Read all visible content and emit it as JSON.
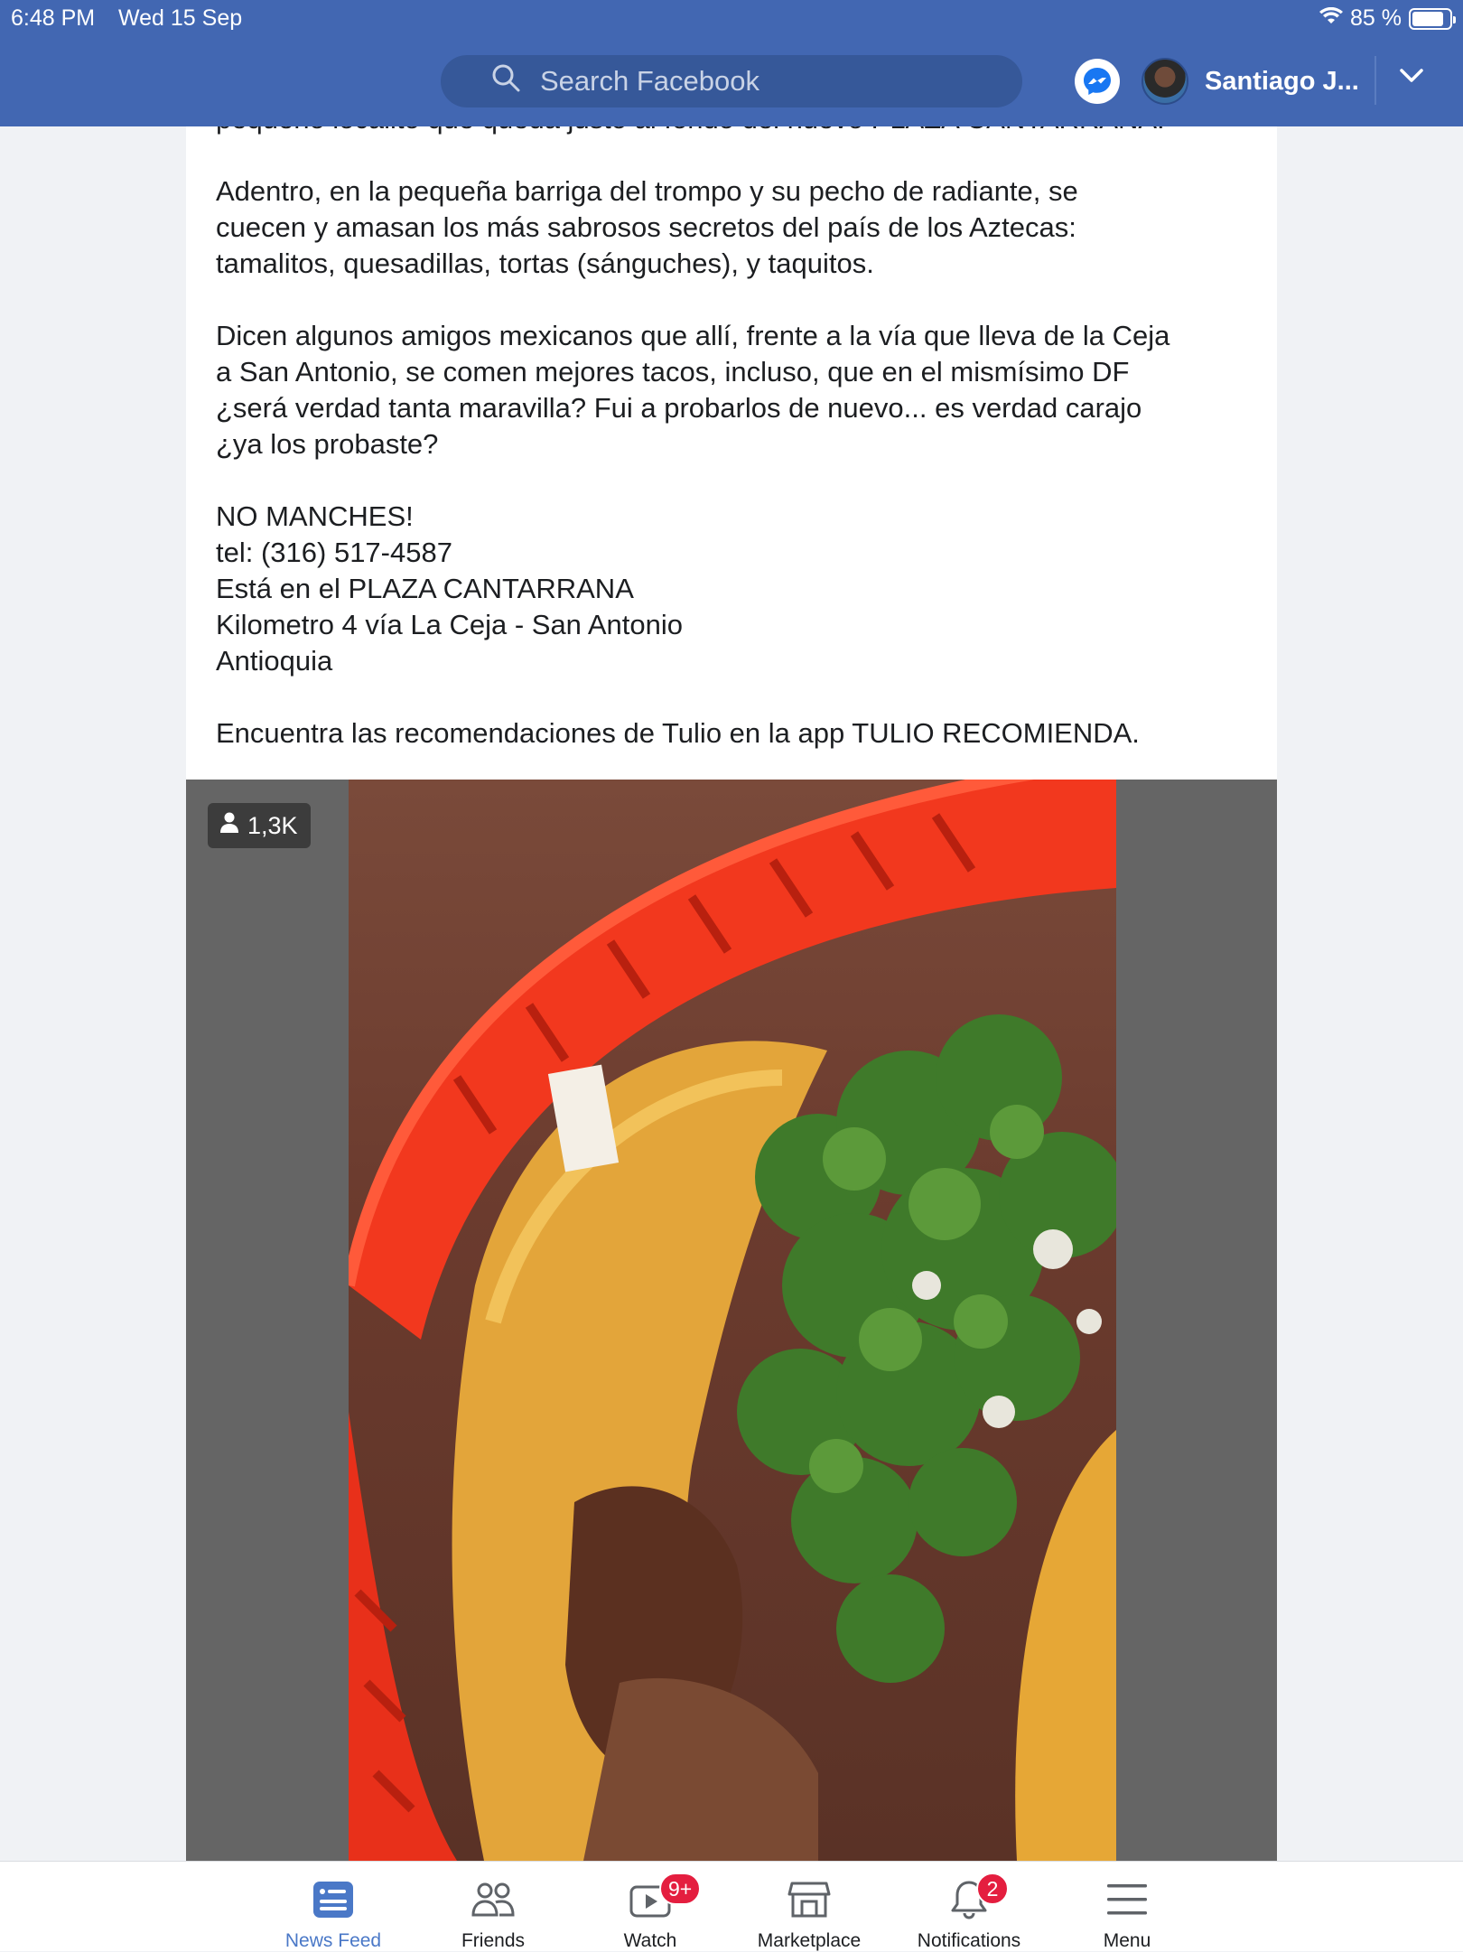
{
  "status_bar": {
    "time": "6:48 PM",
    "date": "Wed 15 Sep",
    "battery": "85 %",
    "battery_level": 0.85
  },
  "header": {
    "search_placeholder": "Search Facebook",
    "user_name": "Santiago J..."
  },
  "post": {
    "paragraphs": [
      "pequeño localito que queda justo al fondo del nuevo PLAZA CANTARRANA.",
      "Adentro, en la pequeña barriga del trompo y su pecho de radiante, se\ncuecen y amasan los más sabrosos secretos del país de los Aztecas:\ntamalitos, quesadillas, tortas (sánguches), y taquitos.",
      "Dicen algunos amigos mexicanos que allí, frente a la vía que lleva de la Ceja\na San Antonio, se comen mejores tacos, incluso, que en el mismísimo DF\n¿será verdad tanta maravilla? Fui a probarlos de nuevo... es verdad carajo\n¿ya los probaste?",
      "NO MANCHES!\ntel: (316) 517-4587\nEstá en el PLAZA CANTARRANA\nKilometro 4 vía La Ceja - San Antonio\nAntioquia",
      "Encuentra las recomendaciones de Tulio en la app TULIO RECOMIENDA."
    ]
  },
  "video": {
    "viewers": "1,3K"
  },
  "bottom_nav": {
    "tabs": [
      {
        "label": "News Feed",
        "icon": "news-feed-icon",
        "active": true
      },
      {
        "label": "Friends",
        "icon": "friends-icon"
      },
      {
        "label": "Watch",
        "icon": "watch-icon",
        "badge": "9+"
      },
      {
        "label": "Marketplace",
        "icon": "marketplace-icon"
      },
      {
        "label": "Notifications",
        "icon": "bell-icon",
        "badge": "2"
      },
      {
        "label": "Menu",
        "icon": "menu-icon"
      }
    ]
  },
  "colors": {
    "header_bg": "#4267b2",
    "active_tab": "#4a78c7",
    "badge": "#e41e3f"
  }
}
